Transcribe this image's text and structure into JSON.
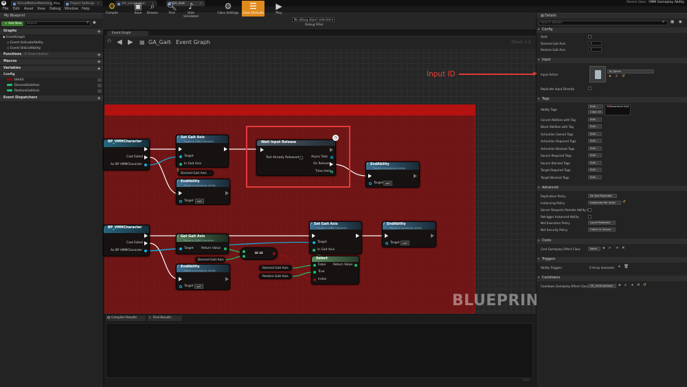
{
  "title_bar": {
    "tabs": [
      "VirtualMotionMatching_Map",
      "Project Settings",
      "GA_Locomotion",
      "GA_Gait"
    ],
    "parent_class_label": "Parent class:",
    "parent_class_value": "VMM Gameplay Ability"
  },
  "menu": [
    "File",
    "Edit",
    "Asset",
    "View",
    "Debug",
    "Window",
    "Help"
  ],
  "left_panel": {
    "tab": "My Blueprint",
    "add_new": "+ Add New",
    "search_placeholder": "Search",
    "graphs_header": "Graphs",
    "event_graph": "EventGraph",
    "events": [
      "Event ActivateAbility",
      "Event OnEndAbility"
    ],
    "functions_header": "Functions",
    "functions_count": "(4 Overridable)",
    "macros_header": "Macros",
    "variables_header": "Variables",
    "config_header": "Config",
    "variables": [
      {
        "name": "bHold",
        "color": "#8a0b0b"
      },
      {
        "name": "DesiredGaitAxis",
        "color": "#21c06d"
      },
      {
        "name": "RestoreGaitAxis",
        "color": "#21c06d"
      }
    ],
    "dispatchers_header": "Event Dispatchers"
  },
  "toolbar": {
    "buttons": [
      {
        "label": "Compile",
        "icon": "compile-icon"
      },
      {
        "label": "Save",
        "icon": "save-icon"
      },
      {
        "label": "Browse",
        "icon": "browse-icon"
      },
      {
        "label": "Find",
        "icon": "find-icon"
      },
      {
        "label": "Hide Unrelated",
        "icon": "hide-unrelated-icon"
      },
      {
        "label": "Class Settings",
        "icon": "class-settings-icon"
      },
      {
        "label": "Class Defaults",
        "icon": "class-defaults-icon"
      },
      {
        "label": "Play",
        "icon": "play-icon"
      }
    ],
    "debug_select": "No debug object selected ▾",
    "debug_filter": "Debug Filter"
  },
  "graph": {
    "tab": "Event Graph",
    "breadcrumb_root": "GA_Gait",
    "breadcrumb_leaf": "Event Graph",
    "zoom": "Zoom 1:1",
    "watermark": "BLUEPRINT",
    "annotation": "Input ID",
    "nodes": {
      "cast1_title": "BP_VMMCharacter",
      "cast_failed": "Cast Failed",
      "as_bp": "As BP VMMCharacter",
      "set_gait_title": "Set Gait Axis",
      "set_gait_sub": "Target is VMM Character",
      "target": "Target",
      "in_gait_axis": "In Gait Axis",
      "desired_gait_axis": "Desired Gait Axis",
      "end_ability": "EndAbility",
      "end_ability_sub": "Target is Gameplay Ability",
      "self": "self",
      "wait_input_release": "Wait Input Release",
      "test_already_released": "Test Already Released",
      "async_task": "Async Task",
      "on_release": "On Release",
      "time_held": "Time Held",
      "get_gait_title": "Get Gait Axis",
      "return_value": "Return Value",
      "equals": "==",
      "select": "Select",
      "false": "False",
      "true": "True",
      "index": "Index",
      "restore_gait_axis": "Restore Gait Axis"
    }
  },
  "bottom_panel": {
    "tabs": [
      "Compiler Results",
      "Find Results"
    ],
    "clear": "Clear"
  },
  "details": {
    "tab": "Details",
    "search_placeholder": "Search Details",
    "config": {
      "header": "Config",
      "hold": "Hold",
      "desired_gait_axis": "Desired Gait Axis",
      "desired_value": "1",
      "restore_gait_axis": "Restore Gait Axis",
      "restore_value": "1"
    },
    "input": {
      "header": "Input",
      "input_action": "Input Action",
      "input_action_value": "IA_Sprint",
      "replicate": "Replicate Input Directly"
    },
    "tags": {
      "header": "Tags",
      "ability_tags": "Ability Tags",
      "edit": "Edit...",
      "clear_all": "Clear All",
      "ability_tag_value": "Movement.Gait",
      "rows": [
        "Cancel Abilities with Tag",
        "Block Abilities with Tag",
        "Activation Owned Tags",
        "Activation Required Tags",
        "Activation Blocked Tags",
        "Source Required Tags",
        "Source Blocked Tags",
        "Target Required Tags",
        "Target Blocked Tags"
      ]
    },
    "advanced": {
      "header": "Advanced",
      "replication_policy": "Replication Policy",
      "replication_value": "Do Not Replicate",
      "instancing_policy": "Instancing Policy",
      "instancing_value": "Instanced Per Actor",
      "server_respects": "Server Respects Remote Ability Cr",
      "retrigger": "Retrigger Instanced Ability",
      "net_execution": "Net Execution Policy",
      "net_execution_value": "Local Predicted",
      "net_security": "Net Security Policy",
      "net_security_value": "Client Or Server"
    },
    "costs": {
      "header": "Costs",
      "cost_effect": "Cost Gameplay Effect Class",
      "cost_value": "None"
    },
    "triggers": {
      "header": "Triggers",
      "ability_triggers": "Ability Triggers",
      "triggers_value": "0 Array elements"
    },
    "cooldowns": {
      "header": "Cooldowns",
      "cooldown_effect": "Cooldown Gameplay Effect Class",
      "cooldown_value": "GE_GaitCooldown"
    }
  }
}
